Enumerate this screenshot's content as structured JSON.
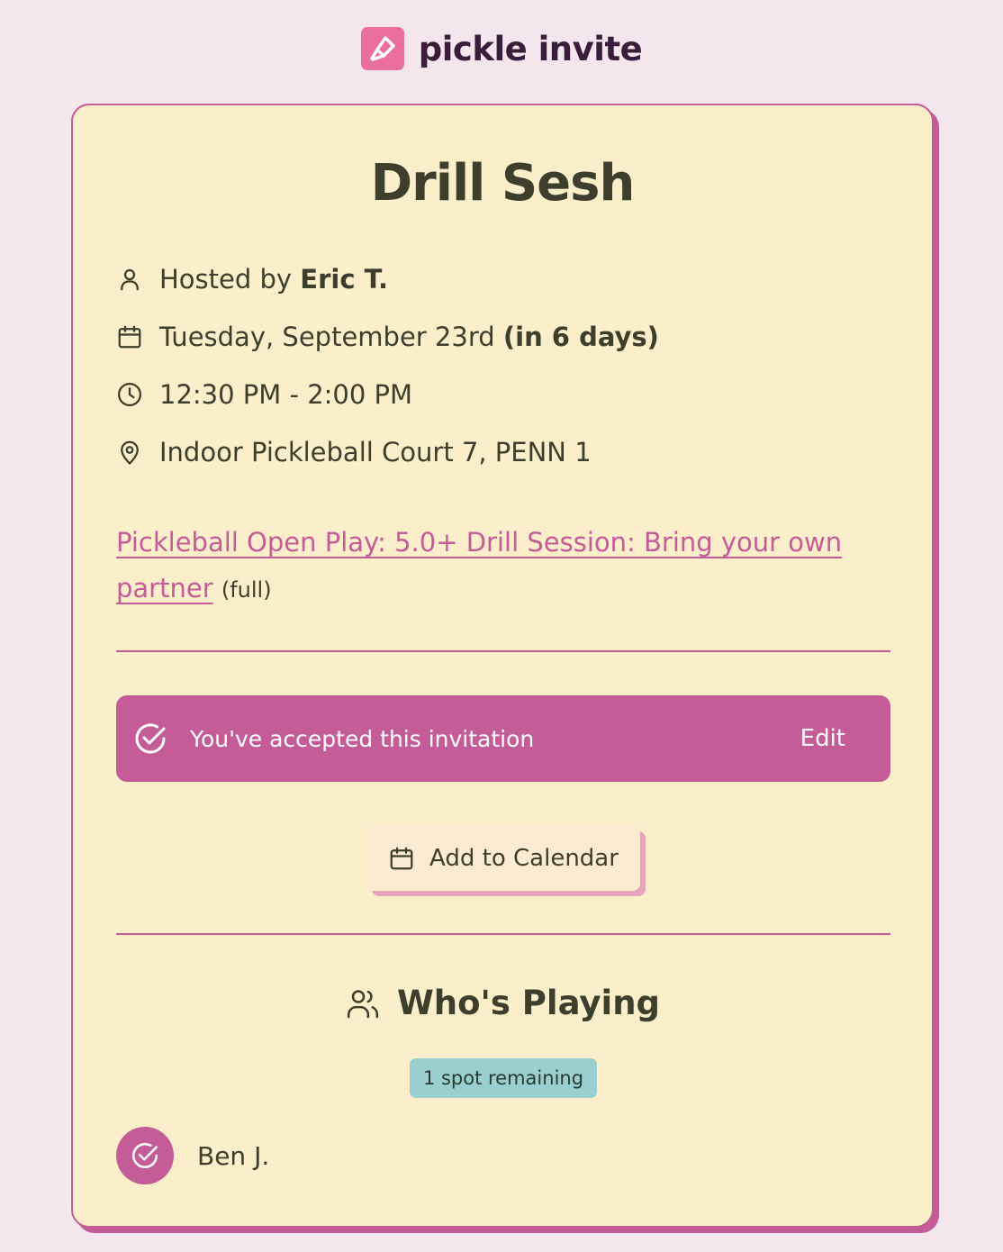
{
  "brand": {
    "name": "pickle invite",
    "logo_icon": "paddle-icon"
  },
  "event": {
    "title": "Drill Sesh",
    "host_prefix": "Hosted by ",
    "host_name": "Eric T.",
    "date": "Tuesday, September 23rd ",
    "date_relative": "(in 6 days)",
    "time": "12:30 PM - 2:00 PM",
    "location": "Indoor Pickleball Court 7, PENN 1",
    "session_link": "Pickleball Open Play: 5.0+ Drill Session: Bring your own partner",
    "session_status": "(full)"
  },
  "rsvp": {
    "status_text": "You've accepted this invitation",
    "edit_label": "Edit"
  },
  "calendar": {
    "label": "Add to Calendar"
  },
  "players": {
    "heading": "Who's Playing",
    "spots_badge": "1 spot remaining",
    "list": [
      {
        "name": "Ben J.",
        "status": "accepted"
      }
    ]
  },
  "colors": {
    "accent": "#c45c97",
    "card": "#fbeeca",
    "background": "#f3e6ed",
    "badge": "#9acfd0"
  }
}
